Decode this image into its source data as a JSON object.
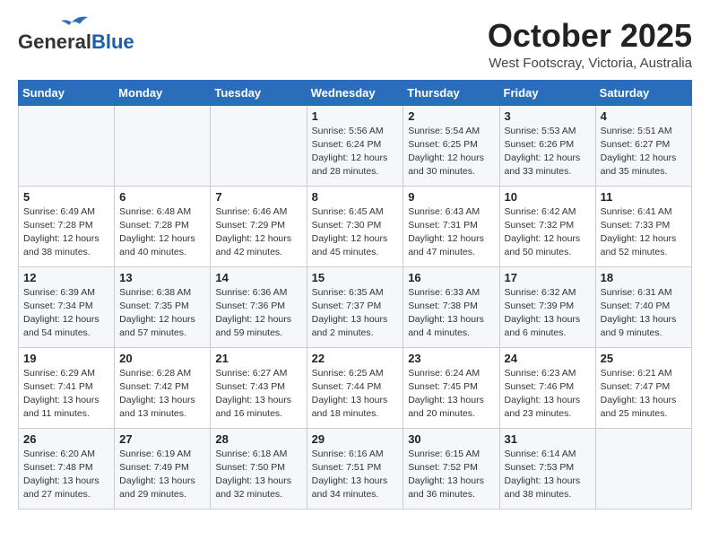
{
  "header": {
    "logo_general": "General",
    "logo_blue": "Blue",
    "month_title": "October 2025",
    "subtitle": "West Footscray, Victoria, Australia"
  },
  "weekdays": [
    "Sunday",
    "Monday",
    "Tuesday",
    "Wednesday",
    "Thursday",
    "Friday",
    "Saturday"
  ],
  "weeks": [
    [
      {
        "day": "",
        "info": ""
      },
      {
        "day": "",
        "info": ""
      },
      {
        "day": "",
        "info": ""
      },
      {
        "day": "1",
        "info": "Sunrise: 5:56 AM\nSunset: 6:24 PM\nDaylight: 12 hours\nand 28 minutes."
      },
      {
        "day": "2",
        "info": "Sunrise: 5:54 AM\nSunset: 6:25 PM\nDaylight: 12 hours\nand 30 minutes."
      },
      {
        "day": "3",
        "info": "Sunrise: 5:53 AM\nSunset: 6:26 PM\nDaylight: 12 hours\nand 33 minutes."
      },
      {
        "day": "4",
        "info": "Sunrise: 5:51 AM\nSunset: 6:27 PM\nDaylight: 12 hours\nand 35 minutes."
      }
    ],
    [
      {
        "day": "5",
        "info": "Sunrise: 6:49 AM\nSunset: 7:28 PM\nDaylight: 12 hours\nand 38 minutes."
      },
      {
        "day": "6",
        "info": "Sunrise: 6:48 AM\nSunset: 7:28 PM\nDaylight: 12 hours\nand 40 minutes."
      },
      {
        "day": "7",
        "info": "Sunrise: 6:46 AM\nSunset: 7:29 PM\nDaylight: 12 hours\nand 42 minutes."
      },
      {
        "day": "8",
        "info": "Sunrise: 6:45 AM\nSunset: 7:30 PM\nDaylight: 12 hours\nand 45 minutes."
      },
      {
        "day": "9",
        "info": "Sunrise: 6:43 AM\nSunset: 7:31 PM\nDaylight: 12 hours\nand 47 minutes."
      },
      {
        "day": "10",
        "info": "Sunrise: 6:42 AM\nSunset: 7:32 PM\nDaylight: 12 hours\nand 50 minutes."
      },
      {
        "day": "11",
        "info": "Sunrise: 6:41 AM\nSunset: 7:33 PM\nDaylight: 12 hours\nand 52 minutes."
      }
    ],
    [
      {
        "day": "12",
        "info": "Sunrise: 6:39 AM\nSunset: 7:34 PM\nDaylight: 12 hours\nand 54 minutes."
      },
      {
        "day": "13",
        "info": "Sunrise: 6:38 AM\nSunset: 7:35 PM\nDaylight: 12 hours\nand 57 minutes."
      },
      {
        "day": "14",
        "info": "Sunrise: 6:36 AM\nSunset: 7:36 PM\nDaylight: 12 hours\nand 59 minutes."
      },
      {
        "day": "15",
        "info": "Sunrise: 6:35 AM\nSunset: 7:37 PM\nDaylight: 13 hours\nand 2 minutes."
      },
      {
        "day": "16",
        "info": "Sunrise: 6:33 AM\nSunset: 7:38 PM\nDaylight: 13 hours\nand 4 minutes."
      },
      {
        "day": "17",
        "info": "Sunrise: 6:32 AM\nSunset: 7:39 PM\nDaylight: 13 hours\nand 6 minutes."
      },
      {
        "day": "18",
        "info": "Sunrise: 6:31 AM\nSunset: 7:40 PM\nDaylight: 13 hours\nand 9 minutes."
      }
    ],
    [
      {
        "day": "19",
        "info": "Sunrise: 6:29 AM\nSunset: 7:41 PM\nDaylight: 13 hours\nand 11 minutes."
      },
      {
        "day": "20",
        "info": "Sunrise: 6:28 AM\nSunset: 7:42 PM\nDaylight: 13 hours\nand 13 minutes."
      },
      {
        "day": "21",
        "info": "Sunrise: 6:27 AM\nSunset: 7:43 PM\nDaylight: 13 hours\nand 16 minutes."
      },
      {
        "day": "22",
        "info": "Sunrise: 6:25 AM\nSunset: 7:44 PM\nDaylight: 13 hours\nand 18 minutes."
      },
      {
        "day": "23",
        "info": "Sunrise: 6:24 AM\nSunset: 7:45 PM\nDaylight: 13 hours\nand 20 minutes."
      },
      {
        "day": "24",
        "info": "Sunrise: 6:23 AM\nSunset: 7:46 PM\nDaylight: 13 hours\nand 23 minutes."
      },
      {
        "day": "25",
        "info": "Sunrise: 6:21 AM\nSunset: 7:47 PM\nDaylight: 13 hours\nand 25 minutes."
      }
    ],
    [
      {
        "day": "26",
        "info": "Sunrise: 6:20 AM\nSunset: 7:48 PM\nDaylight: 13 hours\nand 27 minutes."
      },
      {
        "day": "27",
        "info": "Sunrise: 6:19 AM\nSunset: 7:49 PM\nDaylight: 13 hours\nand 29 minutes."
      },
      {
        "day": "28",
        "info": "Sunrise: 6:18 AM\nSunset: 7:50 PM\nDaylight: 13 hours\nand 32 minutes."
      },
      {
        "day": "29",
        "info": "Sunrise: 6:16 AM\nSunset: 7:51 PM\nDaylight: 13 hours\nand 34 minutes."
      },
      {
        "day": "30",
        "info": "Sunrise: 6:15 AM\nSunset: 7:52 PM\nDaylight: 13 hours\nand 36 minutes."
      },
      {
        "day": "31",
        "info": "Sunrise: 6:14 AM\nSunset: 7:53 PM\nDaylight: 13 hours\nand 38 minutes."
      },
      {
        "day": "",
        "info": ""
      }
    ]
  ]
}
